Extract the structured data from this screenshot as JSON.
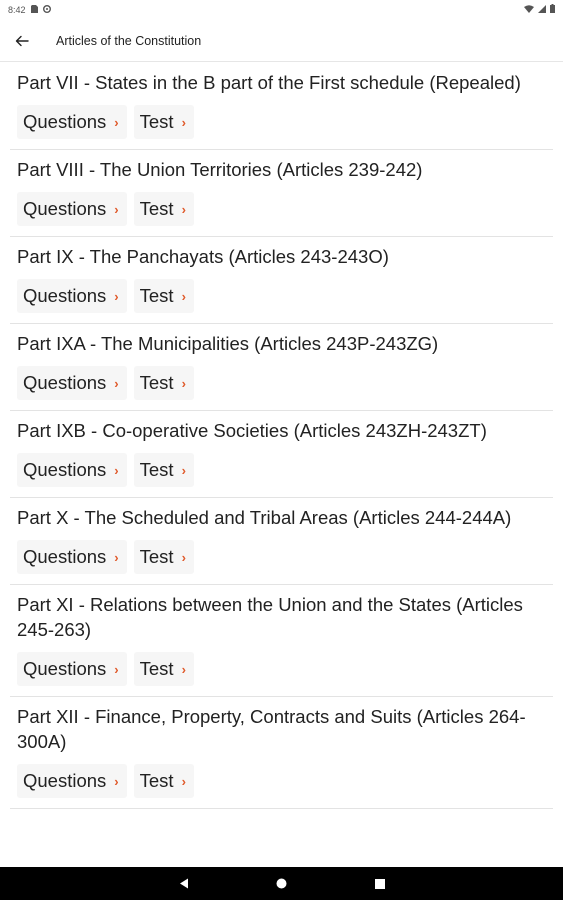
{
  "status_bar": {
    "time": "8:42"
  },
  "app_bar": {
    "title": "Articles of the Constitution"
  },
  "sections": [
    {
      "title": "Part VII - States in the B part of the First schedule (Repealed)",
      "questions": "Questions",
      "test": "Test"
    },
    {
      "title": "Part VIII - The Union Territories (Articles 239-242)",
      "questions": "Questions",
      "test": "Test"
    },
    {
      "title": "Part IX - The Panchayats (Articles 243-243O)",
      "questions": "Questions",
      "test": "Test"
    },
    {
      "title": "Part IXA - The Municipalities (Articles 243P-243ZG)",
      "questions": "Questions",
      "test": "Test"
    },
    {
      "title": "Part IXB - Co-operative Societies (Articles 243ZH-243ZT)",
      "questions": "Questions",
      "test": "Test"
    },
    {
      "title": "Part X - The Scheduled and Tribal Areas (Articles 244-244A)",
      "questions": "Questions",
      "test": "Test"
    },
    {
      "title": "Part XI - Relations between the Union and the States (Articles 245-263)",
      "questions": "Questions",
      "test": "Test"
    },
    {
      "title": "Part XII - Finance, Property, Contracts and Suits (Articles 264-300A)",
      "questions": "Questions",
      "test": "Test"
    }
  ],
  "colors": {
    "accent": "#e05a2b",
    "chip_bg": "#f6f6f6"
  }
}
